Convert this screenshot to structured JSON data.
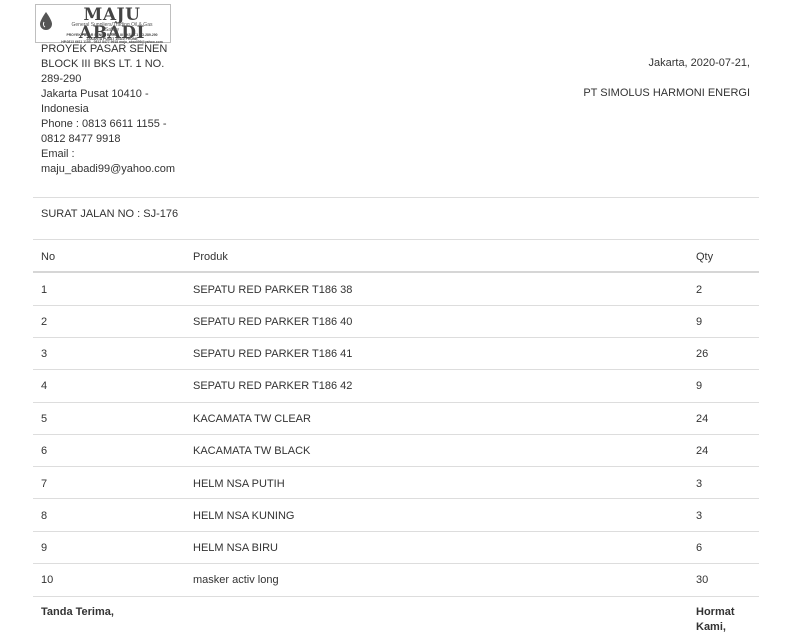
{
  "logo": {
    "name": "MAJU ABADI",
    "tagline": "General Suppliers/Trading Oil & Gas",
    "tagline2": "Safety",
    "line1": "PROYEK PASAR SENEN BLOCK III BKS LT.1 NO.289-290",
    "line2": "JAKARTA PUSAT 10410 PHONE",
    "line3": "HP.0813 6611 1155 - 0812 8477 9918 maju_abadi99@yahoo.com"
  },
  "company": {
    "address_lines": [
      "PROYEK PASAR SENEN",
      "BLOCK III BKS LT. 1 NO.",
      "289-290",
      "Jakarta Pusat 10410 -",
      "Indonesia",
      "Phone : 0813 6611 1155 -",
      "0812 8477 9918",
      "Email :",
      "maju_abadi99@yahoo.com"
    ]
  },
  "date_line": "Jakarta, 2020-07-21,",
  "customer": "PT SIMOLUS HARMONI ENERGI",
  "surat_jalan": "SURAT JALAN NO : SJ-176",
  "table": {
    "headers": [
      "No",
      "Produk",
      "Qty"
    ],
    "rows": [
      [
        "1",
        "SEPATU RED PARKER T186 38",
        "2"
      ],
      [
        "2",
        "SEPATU RED PARKER T186 40",
        "9"
      ],
      [
        "3",
        "SEPATU RED PARKER T186 41",
        "26"
      ],
      [
        "4",
        "SEPATU RED PARKER T186 42",
        "9"
      ],
      [
        "5",
        "KACAMATA TW CLEAR",
        "24"
      ],
      [
        "6",
        "KACAMATA TW BLACK",
        "24"
      ],
      [
        "7",
        "HELM NSA PUTIH",
        "3"
      ],
      [
        "8",
        "HELM NSA KUNING",
        "3"
      ],
      [
        "9",
        "HELM NSA BIRU",
        "6"
      ],
      [
        "10",
        "masker activ long",
        "30"
      ]
    ]
  },
  "footer": {
    "left": "Tanda Terima,",
    "right_line1": "Hormat",
    "right_line2": "Kami,"
  }
}
